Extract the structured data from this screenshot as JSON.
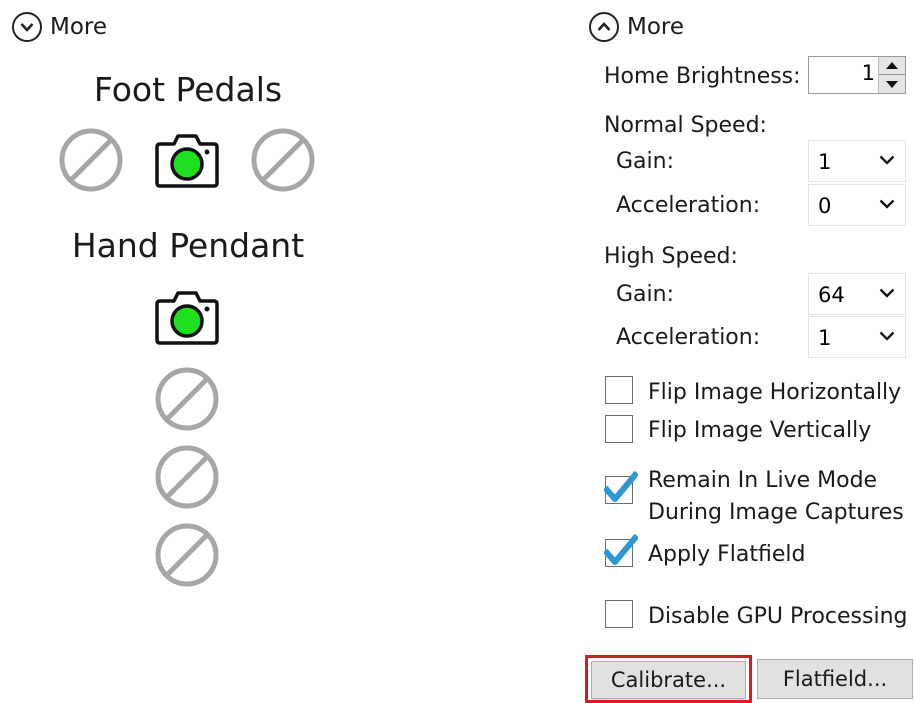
{
  "left_panel": {
    "more_label": "More",
    "more_icon": "chevron-down-circle-icon",
    "foot_pedals": {
      "heading": "Foot Pedals",
      "icons": [
        "disabled-icon",
        "camera-icon",
        "disabled-icon"
      ]
    },
    "hand_pendant": {
      "heading": "Hand Pendant",
      "icons": [
        "camera-icon",
        "disabled-icon",
        "disabled-icon",
        "disabled-icon"
      ]
    }
  },
  "right_panel": {
    "more_label": "More",
    "more_icon": "chevron-up-circle-icon",
    "home_brightness": {
      "label": "Home Brightness:",
      "value": "1"
    },
    "normal_speed": {
      "label": "Normal Speed:",
      "gain_label": "Gain:",
      "gain_value": "1",
      "accel_label": "Acceleration:",
      "accel_value": "0"
    },
    "high_speed": {
      "label": "High Speed:",
      "gain_label": "Gain:",
      "gain_value": "64",
      "accel_label": "Acceleration:",
      "accel_value": "1"
    },
    "checkboxes": [
      {
        "label": "Flip Image Horizontally",
        "checked": false
      },
      {
        "label": "Flip Image Vertically",
        "checked": false
      },
      {
        "label_line1": "Remain In Live Mode",
        "label_line2": "During Image Captures",
        "checked": true
      },
      {
        "label": "Apply Flatfield",
        "checked": true
      },
      {
        "label": "Disable GPU Processing",
        "checked": false
      }
    ],
    "buttons": {
      "calibrate": "Calibrate...",
      "flatfield": "Flatfield..."
    }
  },
  "colors": {
    "active_lens": "#1fe01f",
    "disabled_icon": "#a6a6a6",
    "check_mark": "#2b97d4",
    "highlight_border": "#e2161c"
  }
}
